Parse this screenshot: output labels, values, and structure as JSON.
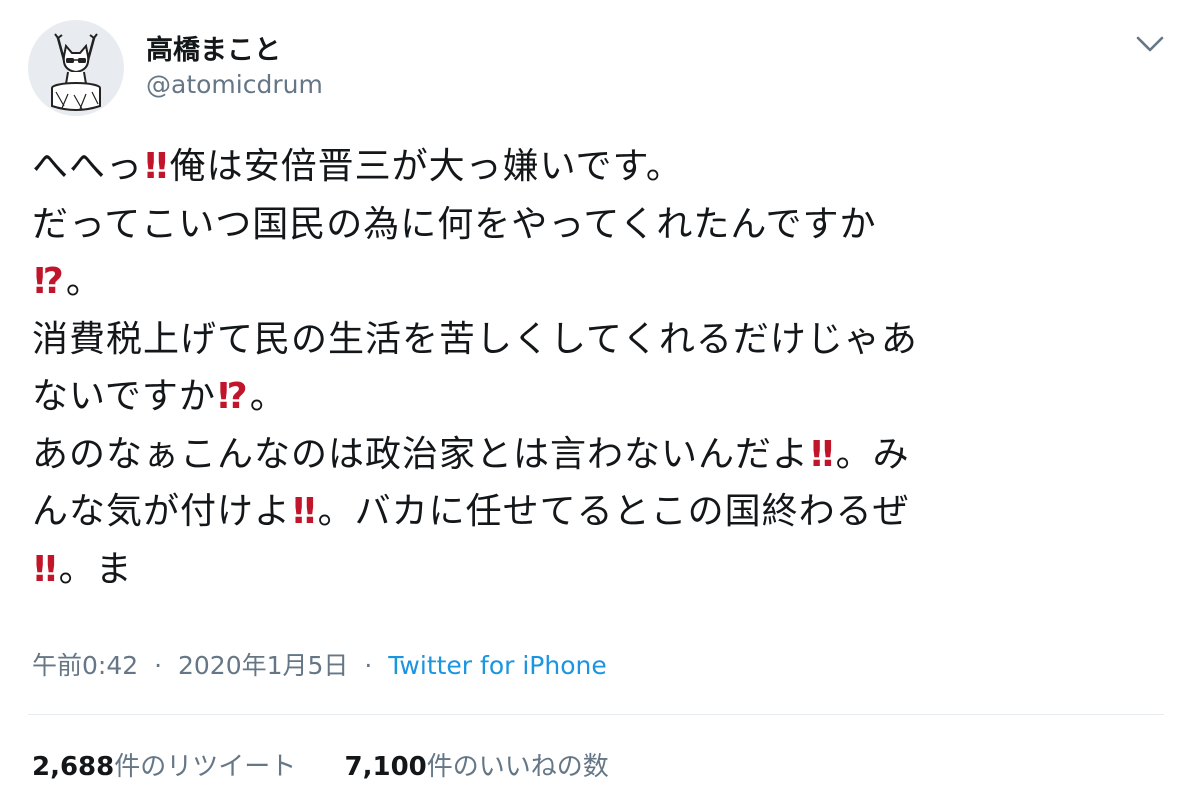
{
  "user": {
    "display_name": "高橋まこと",
    "handle": "@atomicdrum",
    "avatar_icon": "cat-drummer-avatar"
  },
  "caret_icon": "chevron-down-icon",
  "colors": {
    "text": "#14171a",
    "secondary": "#657786",
    "link": "#1b95e0",
    "emoji_red": "#c0152a",
    "divider": "#e6ecf0"
  },
  "tweet": {
    "lines": [
      [
        "へへっ",
        "‼",
        "俺は安倍晋三が大っ嫌いです。"
      ],
      [
        "だってこいつ国民の為に何をやってくれたんですか"
      ],
      [
        "",
        "⁉",
        "。"
      ],
      [
        "消費税上げて民の生活を苦しくしてくれるだけじゃあ"
      ],
      [
        "ないですか",
        "⁉",
        "。"
      ],
      [
        "あのなぁこんなのは政治家とは言わないんだよ",
        "‼",
        "。み"
      ],
      [
        "んな気が付けよ",
        "‼",
        "。バカに任せてるとこの国終わるぜ"
      ],
      [
        "",
        "‼",
        "。ま"
      ]
    ]
  },
  "meta": {
    "time": "午前0:42",
    "separator": "·",
    "date": "2020年1月5日",
    "source": "Twitter for iPhone"
  },
  "stats": {
    "retweets_count": "2,688",
    "retweets_label": "件のリツイート",
    "likes_count": "7,100",
    "likes_label": "件のいいねの数"
  }
}
